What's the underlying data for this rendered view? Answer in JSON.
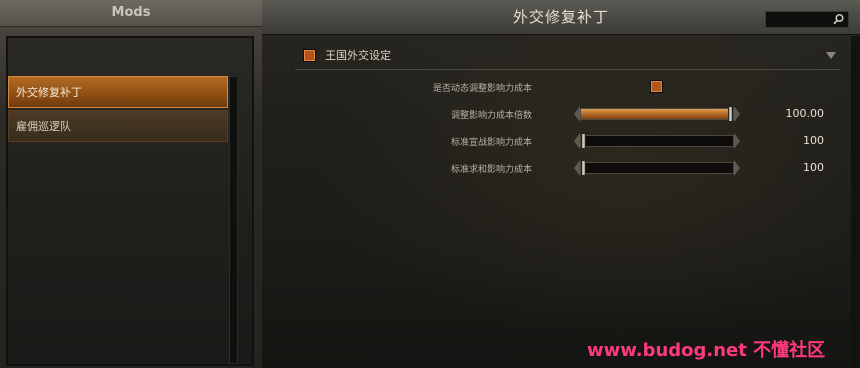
{
  "left_panel": {
    "title": "Mods",
    "mods": [
      {
        "label": "外交修复补丁",
        "active": true
      },
      {
        "label": "雇佣巡逻队",
        "active": false
      }
    ]
  },
  "window": {
    "title": "外交修复补丁"
  },
  "section": {
    "title": "王国外交设定",
    "checked": true
  },
  "settings": [
    {
      "label": "是否动态调整影响力成本",
      "type": "checkbox",
      "checked": true
    },
    {
      "label": "调整影响力成本倍数",
      "type": "slider",
      "value": "100.00",
      "fill": 1.0
    },
    {
      "label": "标准宣战影响力成本",
      "type": "slider",
      "value": "100",
      "fill": 0.0
    },
    {
      "label": "标准求和影响力成本",
      "type": "slider",
      "value": "100",
      "fill": 0.0
    }
  ],
  "watermark": "www.budog.net 不懂社区",
  "colors": {
    "accent": "#b4561b",
    "active_item": "#b06a23",
    "watermark": "#ff3a7a"
  },
  "icons": {
    "search": "search-icon",
    "collapse": "chevron-down-icon"
  }
}
